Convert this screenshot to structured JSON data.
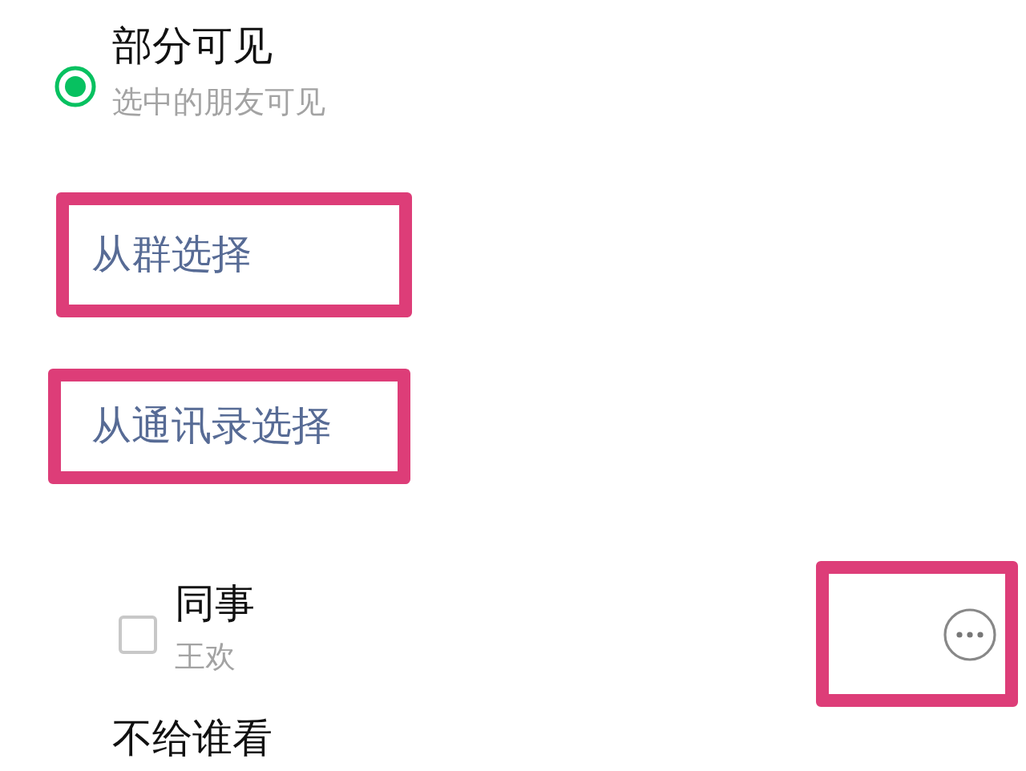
{
  "visibility_option": {
    "title": "部分可见",
    "subtitle": "选中的朋友可见",
    "selected": true
  },
  "links": [
    {
      "label": "从群选择",
      "highlighted": true
    },
    {
      "label": "从通讯录选择",
      "highlighted": true
    }
  ],
  "tags": [
    {
      "name": "同事",
      "members": "王欢",
      "checked": false,
      "more_highlighted": true
    }
  ],
  "next_option": {
    "title": "不给谁看"
  }
}
